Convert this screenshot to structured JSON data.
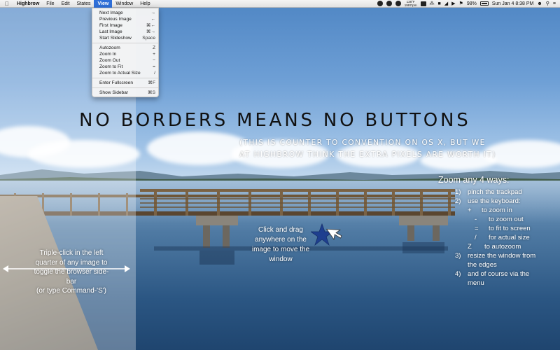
{
  "menubar": {
    "apple_icon": "apple-icon",
    "app_name": "Highbrow",
    "menus": [
      "File",
      "Edit",
      "States",
      "View",
      "Window",
      "Help"
    ],
    "active_menu": "View",
    "status": {
      "temp_top": "138°F",
      "temp_bottom": "1997rpm",
      "battery": "98%",
      "datetime": "Sun Jan 4  8:38 PM"
    }
  },
  "view_menu": {
    "items": [
      {
        "label": "Next Image",
        "shortcut": "→"
      },
      {
        "label": "Previous Image",
        "shortcut": "←"
      },
      {
        "label": "First Image",
        "shortcut": "⌘←"
      },
      {
        "label": "Last Image",
        "shortcut": "⌘→"
      },
      {
        "label": "Start Slideshow",
        "shortcut": "Space"
      },
      {
        "label": "Autozoom",
        "shortcut": "Z"
      },
      {
        "label": "Zoom In",
        "shortcut": "+"
      },
      {
        "label": "Zoom Out",
        "shortcut": "−"
      },
      {
        "label": "Zoom to Fit",
        "shortcut": "="
      },
      {
        "label": "Zoom to Actual Size",
        "shortcut": "/"
      },
      {
        "label": "Enter Fullscreen",
        "shortcut": "⌘F"
      },
      {
        "label": "Show Sidebar",
        "shortcut": "⌘S"
      }
    ]
  },
  "overlay": {
    "headline": "NO BORDERS MEANS NO BUTTONS",
    "subline_1": "(THIS IS COUNTER TO CONVENTION ON OS X, BUT WE",
    "subline_2": "AT HIGHBROW THINK THE EXTRA PIXELS ARE WORTH IT)",
    "zoom_title": "Zoom any 4 ways:",
    "zoom_1_num": "1)",
    "zoom_1": "pinch the trackpad",
    "zoom_2_num": "2)",
    "zoom_2": "use the keyboard:",
    "key_plus": "+",
    "key_plus_txt": "to zoom in",
    "key_minus": "-",
    "key_minus_txt": "to zoom out",
    "key_eq": "=",
    "key_eq_txt": "to fit to screen",
    "key_slash": "/",
    "key_slash_txt": "for actual size",
    "key_z": "Z",
    "key_z_txt": "to autozoom",
    "zoom_3_num": "3)",
    "zoom_3a": "resize the window from",
    "zoom_3b": "the edges",
    "zoom_4_num": "4)",
    "zoom_4a": "and of course via the",
    "zoom_4b": "menu",
    "drag_1": "Click and drag",
    "drag_2": "anywhere on the",
    "drag_3": "image to move the",
    "drag_4": "window",
    "left_1": "Triple-click in the left",
    "left_2": "quarter of any image to",
    "left_3": "toggle the browser side-",
    "left_4": "bar",
    "left_5": "(or type Command-'S')"
  }
}
